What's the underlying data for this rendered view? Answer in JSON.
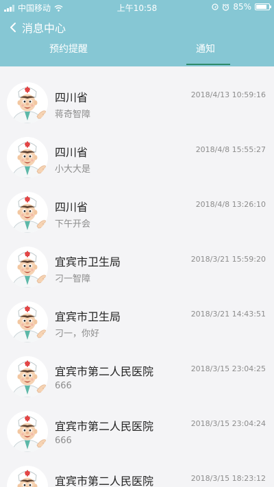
{
  "status_bar": {
    "carrier": "中国移动",
    "time": "上午10:58",
    "battery_percent": "85%",
    "battery_level": 0.85,
    "icons": [
      "signal-icon",
      "wifi-icon",
      "location-icon",
      "alarm-icon",
      "battery-icon"
    ]
  },
  "header": {
    "back_icon": "chevron-left-icon",
    "title": "消息中心",
    "background_color": "#86c7d4"
  },
  "tabs": [
    {
      "label": "预约提醒",
      "active": false
    },
    {
      "label": "通知",
      "active": true
    }
  ],
  "accent_color": "#2e8a6a",
  "messages": [
    {
      "title": "四川省",
      "subtitle": "蒋奇智障",
      "time": "2018/4/13 10:59:16",
      "avatar": "doctor-avatar"
    },
    {
      "title": "四川省",
      "subtitle": "小大大是",
      "time": "2018/4/8 15:55:27",
      "avatar": "doctor-avatar"
    },
    {
      "title": "四川省",
      "subtitle": "下午开会",
      "time": "2018/4/8 13:26:10",
      "avatar": "doctor-avatar"
    },
    {
      "title": "宜宾市卫生局",
      "subtitle": "刁一智障",
      "time": "2018/3/21 15:59:20",
      "avatar": "doctor-avatar"
    },
    {
      "title": "宜宾市卫生局",
      "subtitle": "刁一，你好",
      "time": "2018/3/21 14:43:51",
      "avatar": "doctor-avatar"
    },
    {
      "title": "宜宾市第二人民医院",
      "subtitle": "666",
      "time": "2018/3/15 23:04:25",
      "avatar": "doctor-avatar"
    },
    {
      "title": "宜宾市第二人民医院",
      "subtitle": "666",
      "time": "2018/3/15 23:04:24",
      "avatar": "doctor-avatar"
    },
    {
      "title": "宜宾市第二人民医院",
      "subtitle": "",
      "time": "2018/3/15 18:23:12",
      "avatar": "doctor-avatar"
    }
  ]
}
